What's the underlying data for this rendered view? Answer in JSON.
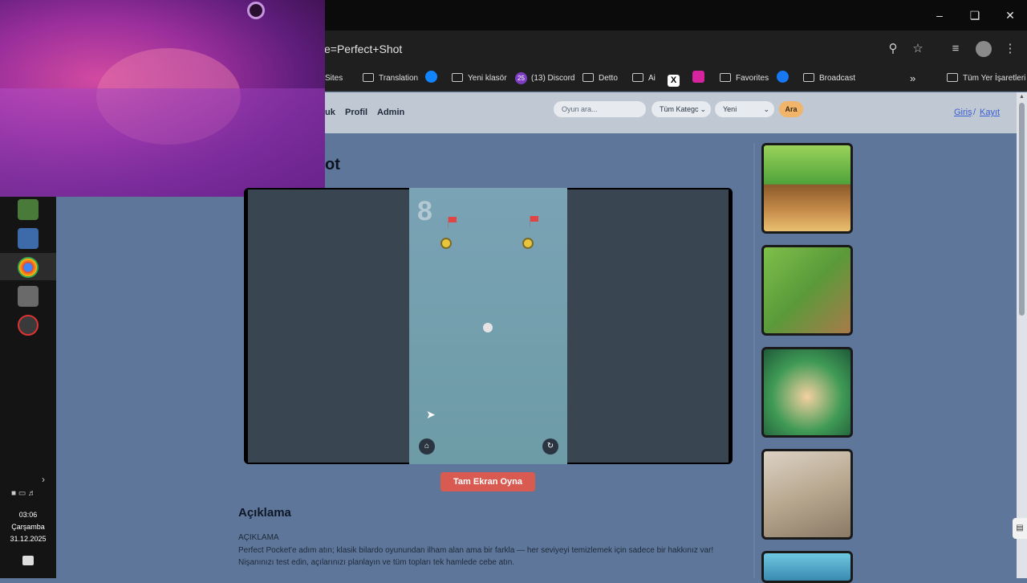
{
  "browser": {
    "url_fragment": "e=Perfect+Shot",
    "bookmarks": [
      {
        "label": "Sites"
      },
      {
        "label": "Translation"
      },
      {
        "label": "Yeni klasör"
      },
      {
        "label": "(13) Discord",
        "badge": "25"
      },
      {
        "label": "Detto"
      },
      {
        "label": "Ai"
      },
      {
        "label": "Favorites"
      },
      {
        "label": "Broadcast"
      }
    ],
    "all_bookmarks": "Tüm Yer İşaretleri"
  },
  "taskbar": {
    "time": "03:06",
    "day": "Çarşamba",
    "date": "31.12.2025"
  },
  "site": {
    "nav": [
      "uk",
      "Profil",
      "Admin"
    ],
    "search_placeholder": "Oyun ara...",
    "category": "Tüm Kategc",
    "sort": "Yeni",
    "search_button": "Ara",
    "login": "Giriş",
    "separator": "/",
    "register": "Kayıt"
  },
  "game": {
    "title_fragment": "ot",
    "score": "8",
    "fullscreen_button": "Tam Ekran Oyna"
  },
  "description": {
    "heading": "Açıklama",
    "label": "AÇIKLAMA",
    "text": "Perfect Pocket'e adım atın; klasik bilardo oyunundan ilham alan ama bir farkla — her seviyeyi temizlemek için sadece bir hakkınız var! Nişanınızı test edin, açılarınızı planlayın ve tüm topları tek hamlede cebe atın."
  },
  "colors": {
    "page_bg": "#5e7699",
    "header_bg": "#c0c8d3",
    "accent": "#d85a50",
    "link": "#3a5fd0"
  }
}
